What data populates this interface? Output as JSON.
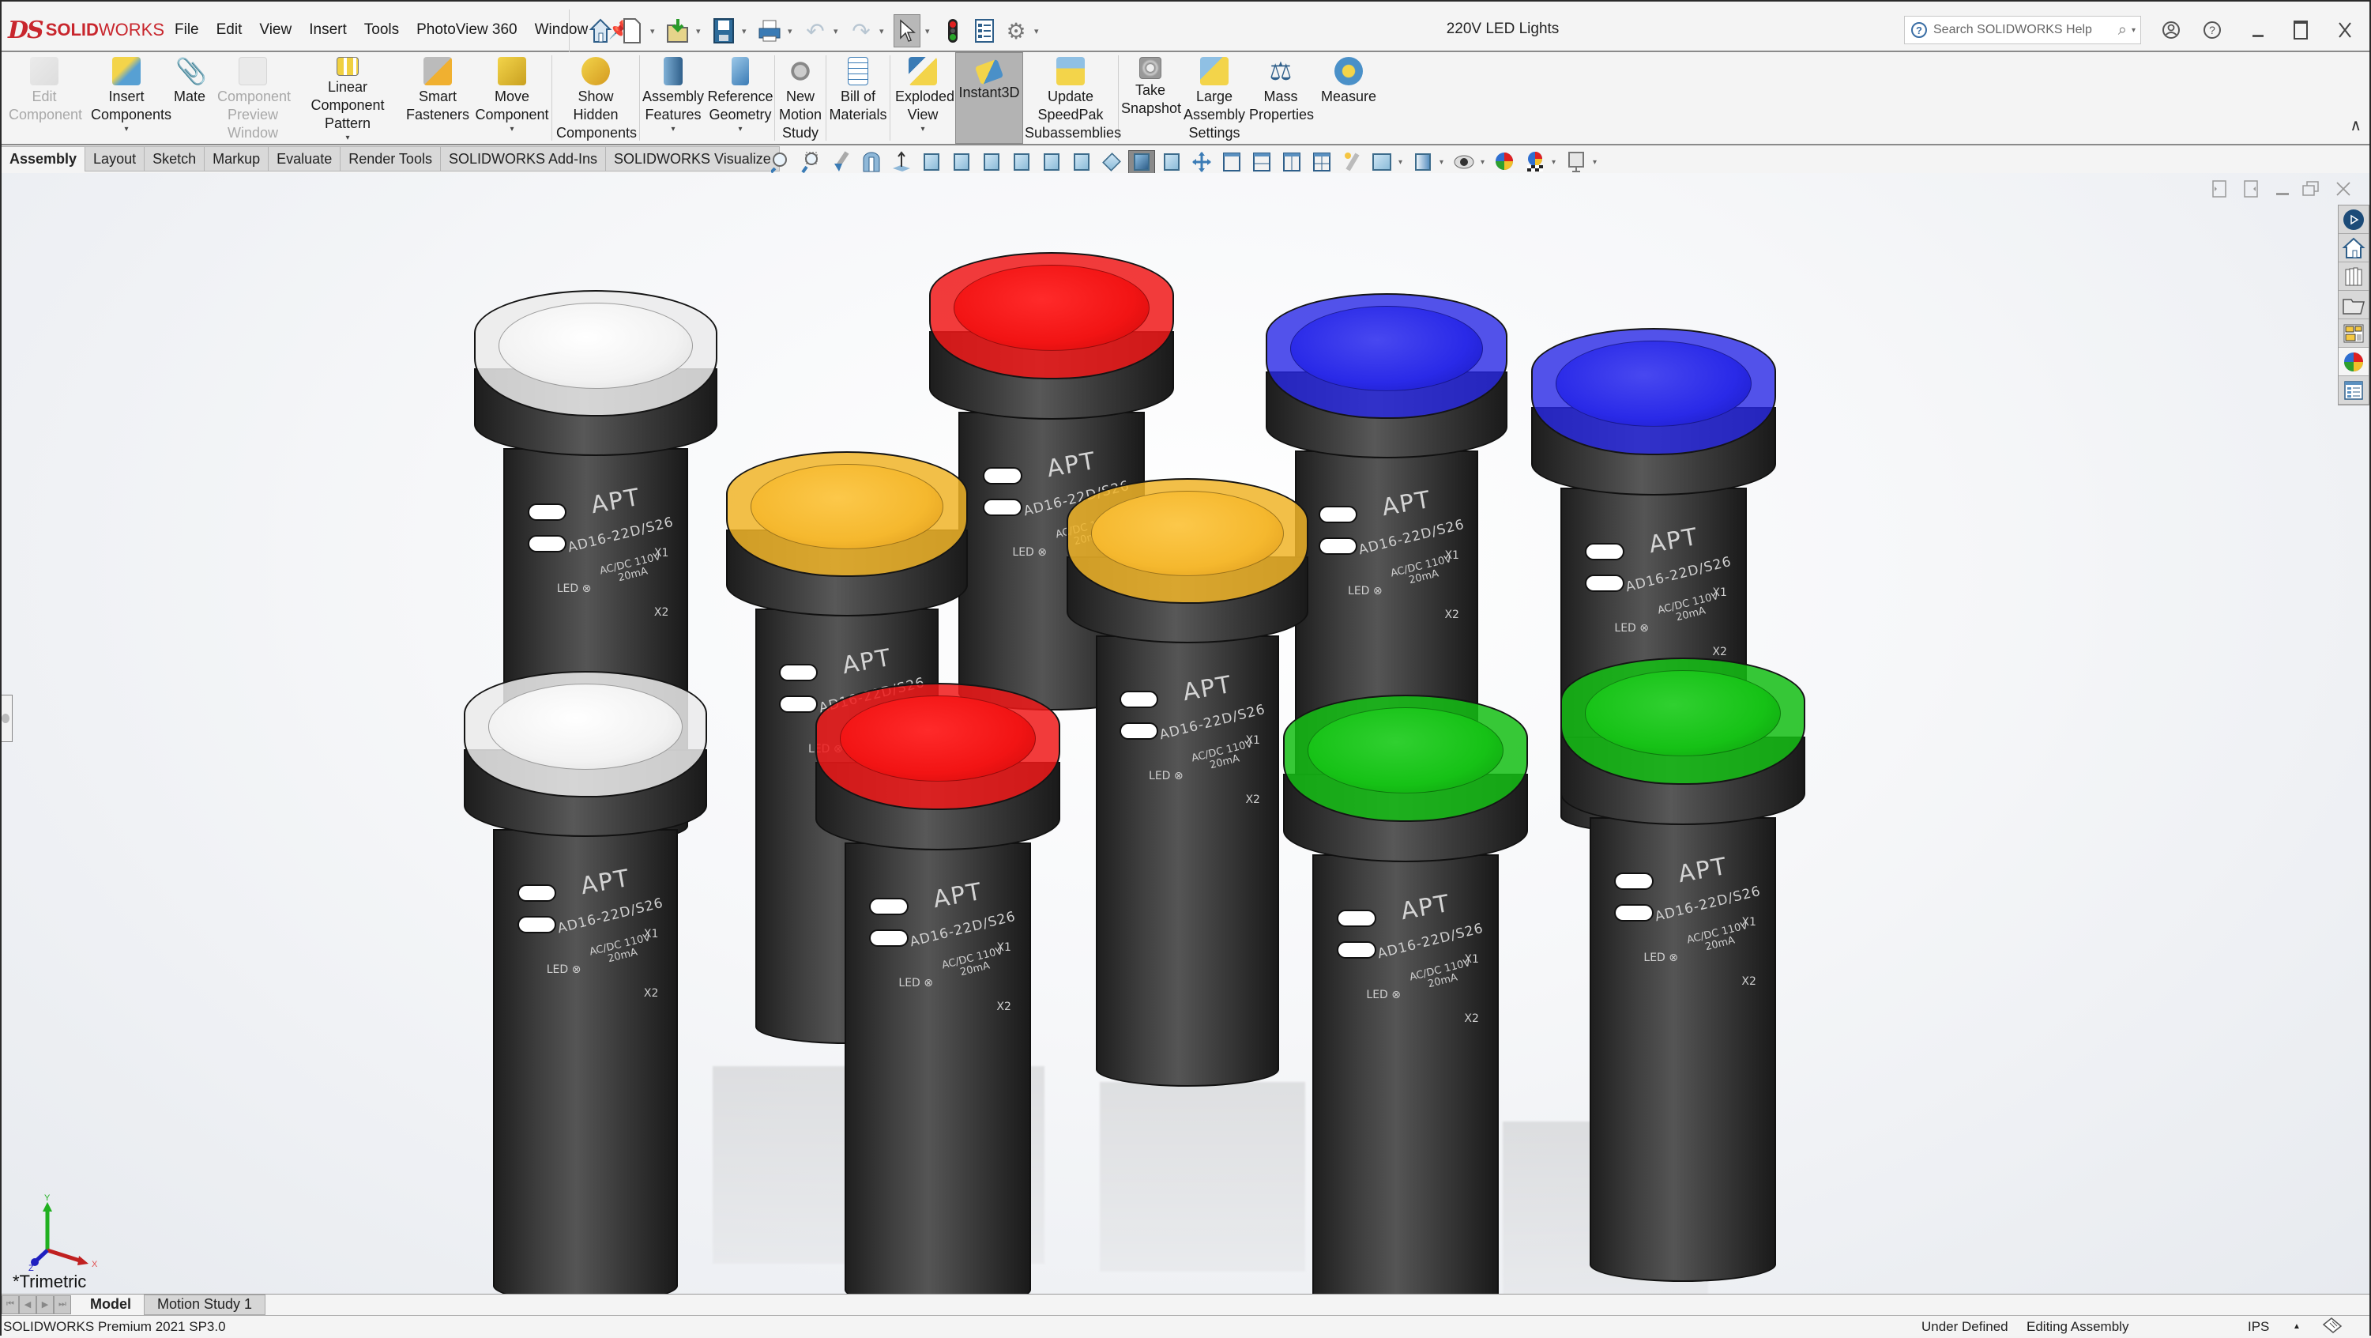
{
  "app": {
    "logo_ds": "DS",
    "logo_bold": "SOLID",
    "logo_light": "WORKS",
    "document_title": "220V LED Lights"
  },
  "menu": [
    "File",
    "Edit",
    "View",
    "Insert",
    "Tools",
    "PhotoView 360",
    "Window"
  ],
  "quick_access": [
    {
      "name": "home-icon"
    },
    {
      "name": "new-document-icon",
      "dropdown": true
    },
    {
      "name": "open-icon",
      "dropdown": true
    },
    {
      "name": "save-icon",
      "dropdown": true
    },
    {
      "name": "print-icon",
      "dropdown": true
    },
    {
      "name": "undo-icon",
      "dropdown": true
    },
    {
      "name": "redo-icon",
      "dropdown": true
    },
    {
      "name": "select-icon",
      "dropdown": true,
      "selected": true
    },
    {
      "name": "rebuild-traffic-light-icon"
    },
    {
      "name": "file-properties-icon"
    },
    {
      "name": "options-gear-icon",
      "dropdown": true
    }
  ],
  "search": {
    "placeholder": "Search SOLIDWORKS Help"
  },
  "ribbon": [
    {
      "label": "Edit Component",
      "disabled": true
    },
    {
      "label": "Insert Components",
      "dropdown": true
    },
    {
      "label": "Mate"
    },
    {
      "label": "Component Preview Window",
      "disabled": true
    },
    {
      "label": "Linear Component Pattern",
      "dropdown": true
    },
    {
      "label": "Smart Fasteners"
    },
    {
      "label": "Move Component",
      "dropdown": true
    },
    {
      "label": "Show Hidden Components"
    },
    {
      "label": "Assembly Features",
      "dropdown": true
    },
    {
      "label": "Reference Geometry",
      "dropdown": true
    },
    {
      "label": "New Motion Study"
    },
    {
      "label": "Bill of Materials"
    },
    {
      "label": "Exploded View",
      "dropdown": true
    },
    {
      "label": "Instant3D",
      "active": true
    },
    {
      "label": "Update SpeedPak Subassemblies"
    },
    {
      "label": "Take Snapshot"
    },
    {
      "label": "Large Assembly Settings"
    },
    {
      "label": "Mass Properties"
    },
    {
      "label": "Measure"
    }
  ],
  "tabs": [
    "Assembly",
    "Layout",
    "Sketch",
    "Markup",
    "Evaluate",
    "Render Tools",
    "SOLIDWORKS Add-Ins",
    "SOLIDWORKS Visualize"
  ],
  "active_tab": "Assembly",
  "hud_tools": [
    "zoom-to-fit",
    "zoom-to-area",
    "previous-view",
    "section-view",
    "normal-to",
    "front-view",
    "back-view",
    "left-view",
    "right-view",
    "top-view",
    "bottom-view",
    "isometric-view",
    "trimetric-view",
    "dimetric-view",
    "3d-drag",
    "single-view",
    "two-view-horizontal",
    "two-view-vertical",
    "four-view",
    "lights",
    "view-orientation",
    "display-style",
    "hide-show-items",
    "edit-appearance",
    "apply-scene",
    "view-settings"
  ],
  "task_pane": [
    "solidworks-resources",
    "home",
    "design-library",
    "file-explorer",
    "view-palette",
    "appearances-scenes-decals",
    "custom-properties"
  ],
  "viewport": {
    "view_label": "*Trimetric",
    "triad": {
      "x": "X",
      "y": "Y",
      "z": "Z"
    },
    "leds": [
      {
        "color": "white",
        "brand": "APT",
        "model": "AD16-22D/S26"
      },
      {
        "color": "red",
        "brand": "APT",
        "model": "AD16-22D/S26"
      },
      {
        "color": "blue",
        "brand": "APT",
        "model": "AD16-22D/S26"
      },
      {
        "color": "blue",
        "brand": "APT",
        "model": "AD16-22D/S26"
      },
      {
        "color": "amber",
        "brand": "APT",
        "model": "AD16-22D/S26"
      },
      {
        "color": "amber",
        "brand": "APT",
        "model": "AD16-22D/S26"
      },
      {
        "color": "white",
        "brand": "APT",
        "model": "AD16-22D/S26"
      },
      {
        "color": "red",
        "brand": "APT",
        "model": "AD16-22D/S26"
      },
      {
        "color": "green",
        "brand": "APT",
        "model": "AD16-22D/S26"
      },
      {
        "color": "green",
        "brand": "APT",
        "model": "AD16-22D/S26"
      }
    ],
    "label_text": {
      "spec_line1": "AC/DC 110V",
      "spec_line2": "20mA",
      "led_tag": "LED",
      "terminal1": "X1",
      "terminal2": "X2"
    }
  },
  "colors": {
    "white": "#f2f2f2",
    "red": "#f21414",
    "blue": "#2a2ae8",
    "amber": "#f5b82e",
    "green": "#16c216",
    "brand": "#c8262d"
  },
  "bottom_tabs": [
    "Model",
    "Motion Study 1"
  ],
  "status": {
    "product": "SOLIDWORKS Premium 2021 SP3.0",
    "definition": "Under Defined",
    "mode": "Editing Assembly",
    "units": "IPS"
  }
}
